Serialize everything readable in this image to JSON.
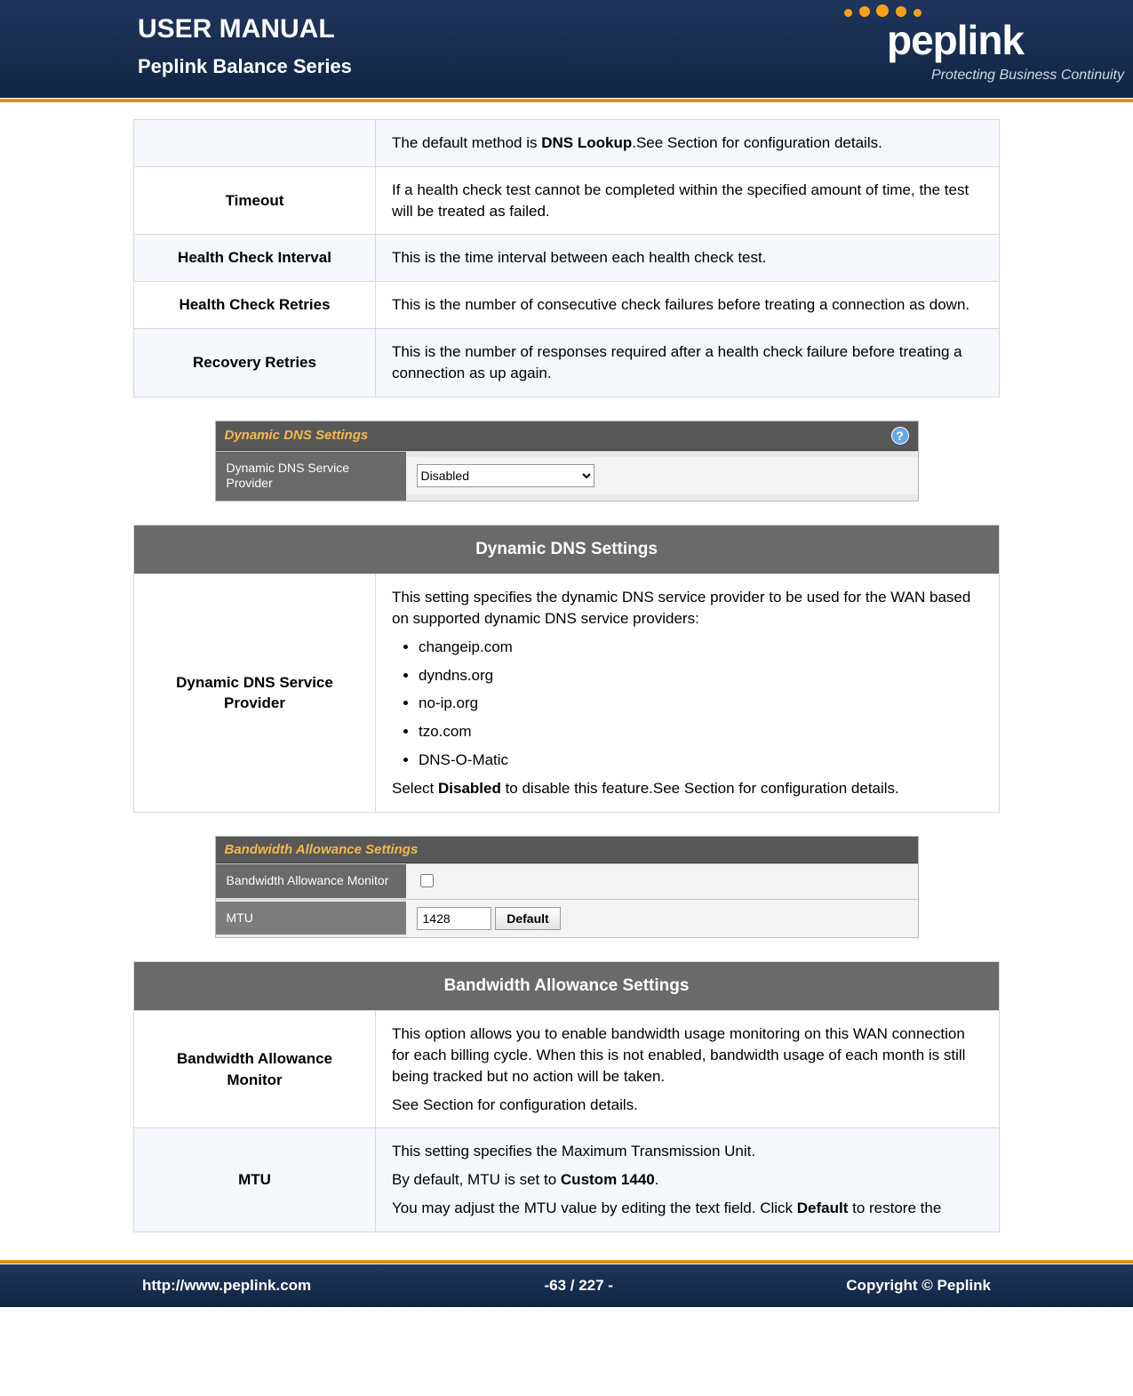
{
  "header": {
    "title": "USER MANUAL",
    "subtitle": "Peplink Balance Series",
    "brand": "peplink",
    "tagline": "Protecting Business Continuity"
  },
  "footer": {
    "url": "http://www.peplink.com",
    "page": "-63 / 227 -",
    "copyright": "Copyright ©  Peplink"
  },
  "health_check": {
    "default_prefix": "The default method is ",
    "default_bold": "DNS Lookup",
    "default_suffix": ".See Section  for configuration details.",
    "rows": [
      {
        "label": "Timeout",
        "text": "If a health check test cannot be completed within the specified amount of time, the test will be treated as failed."
      },
      {
        "label": "Health Check Interval",
        "text": "This is the time interval between each health check test."
      },
      {
        "label": "Health Check Retries",
        "text": "This is the number of consecutive check failures before treating a connection as down."
      },
      {
        "label": "Recovery Retries",
        "text": "This is the number of responses required after a health check failure before treating a connection as up again."
      }
    ]
  },
  "ddns_panel": {
    "title": "Dynamic DNS Settings",
    "row_label": "Dynamic DNS Service Provider",
    "select_value": "Disabled"
  },
  "ddns_section": {
    "heading": "Dynamic DNS Settings",
    "label": "Dynamic DNS Service Provider",
    "intro": "This setting specifies the dynamic DNS service provider to be used for the WAN based on supported dynamic DNS service providers:",
    "providers": [
      "changeip.com",
      "dyndns.org",
      "no-ip.org",
      "tzo.com",
      "DNS-O-Matic"
    ],
    "outro_prefix": "Select ",
    "outro_bold": "Disabled",
    "outro_suffix": " to disable this feature.See Section  for configuration details."
  },
  "bw_panel": {
    "title": "Bandwidth Allowance Settings",
    "row1_label": "Bandwidth Allowance Monitor",
    "row2_label": "MTU",
    "mtu_value": "1428",
    "btn": "Default"
  },
  "bw_section": {
    "heading": "Bandwidth Allowance Settings",
    "rows": [
      {
        "label": "Bandwidth Allowance Monitor",
        "p1": "This option allows you to enable bandwidth usage monitoring on this WAN connection for each billing cycle.  When this is not enabled, bandwidth usage of each month is still being tracked but no action will be taken.",
        "p2": "See Section  for configuration details."
      },
      {
        "label": "MTU",
        "p1": "This setting specifies the Maximum Transmission Unit.",
        "p2_prefix": "By default, MTU is set to ",
        "p2_bold": "Custom 1440",
        "p2_suffix": ".",
        "p3_prefix": "You may adjust the MTU value by editing the text field. Click ",
        "p3_bold": "Default",
        "p3_suffix": " to restore the"
      }
    ]
  }
}
